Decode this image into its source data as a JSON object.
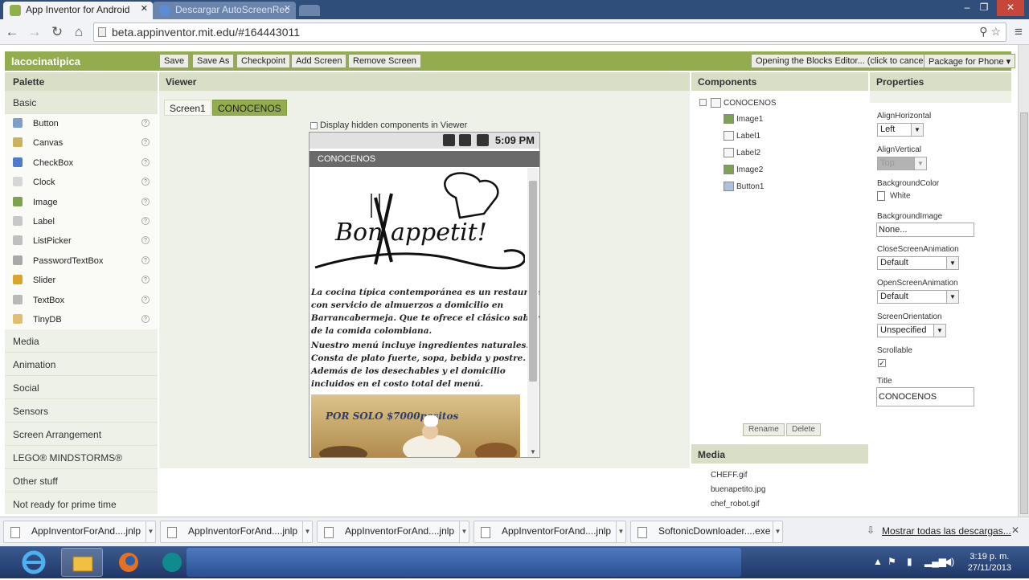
{
  "browser": {
    "tabs": [
      {
        "label": "App Inventor for Android"
      },
      {
        "label": "Descargar AutoScreenRec"
      }
    ],
    "url": "beta.appinventor.mit.edu/#164443011"
  },
  "app": {
    "project_name": "lacocinatipica",
    "toolbar": {
      "save": "Save",
      "save_as": "Save As",
      "checkpoint": "Checkpoint",
      "add_screen": "Add Screen",
      "remove_screen": "Remove Screen",
      "blocks_editor": "Opening the Blocks Editor... (click to cancel)",
      "package": "Package for Phone ▾"
    }
  },
  "palette": {
    "title": "Palette",
    "basic_label": "Basic",
    "basic_items": [
      {
        "label": "Button",
        "icon": "button-icon",
        "color": "#7d9fc9"
      },
      {
        "label": "Canvas",
        "icon": "canvas-icon",
        "color": "#c9b35c"
      },
      {
        "label": "CheckBox",
        "icon": "checkbox-icon",
        "color": "#4e7cc9"
      },
      {
        "label": "Clock",
        "icon": "clock-icon",
        "color": "#d7d7d7"
      },
      {
        "label": "Image",
        "icon": "image-icon",
        "color": "#7ea34f"
      },
      {
        "label": "Label",
        "icon": "label-icon",
        "color": "#c8c8c8"
      },
      {
        "label": "ListPicker",
        "icon": "listpicker-icon",
        "color": "#bfbfbf"
      },
      {
        "label": "PasswordTextBox",
        "icon": "password-icon",
        "color": "#a9a9a9"
      },
      {
        "label": "Slider",
        "icon": "slider-icon",
        "color": "#d9a52b"
      },
      {
        "label": "TextBox",
        "icon": "textbox-icon",
        "color": "#b9b9b9"
      },
      {
        "label": "TinyDB",
        "icon": "tinydb-icon",
        "color": "#e0c070"
      }
    ],
    "categories": [
      "Media",
      "Animation",
      "Social",
      "Sensors",
      "Screen Arrangement",
      "LEGO® MINDSTORMS®",
      "Other stuff",
      "Not ready for prime time"
    ]
  },
  "viewer": {
    "title": "Viewer",
    "screen_tabs": [
      "Screen1",
      "CONOCENOS"
    ],
    "hidden_components_label": "Display hidden components in Viewer",
    "phone_time": "5:09 PM",
    "phone_title": "CONOCENOS",
    "logo_text": "Bon appetit!",
    "paragraph1": [
      "La cocina típica contemporánea es un restaurante",
      "con servicio de almuerzos a domicilio en",
      "Barrancabermeja. Que te ofrece el clásico sabor",
      "de la comida colombiana."
    ],
    "paragraph2": [
      "Nuestro menú incluye ingredientes naturales.",
      "Consta de plato fuerte, sopa, bebida y postre.",
      "Además de los desechables y el domicilio",
      "incluidos en el costo total del menú."
    ],
    "banner_text": "POR SOLO $7000pesitos"
  },
  "components": {
    "title": "Components",
    "root": "CONOCENOS",
    "items": [
      "Image1",
      "Label1",
      "Label2",
      "Image2",
      "Button1"
    ],
    "rename": "Rename",
    "delete": "Delete"
  },
  "media": {
    "title": "Media",
    "files": [
      "CHEFF.gif",
      "buenapetito.jpg",
      "chef_robot.gif"
    ]
  },
  "properties": {
    "title": "Properties",
    "align_horizontal_label": "AlignHorizontal",
    "align_horizontal_value": "Left",
    "align_vertical_label": "AlignVertical",
    "align_vertical_value": "Top",
    "background_color_label": "BackgroundColor",
    "background_color_value": "White",
    "background_image_label": "BackgroundImage",
    "background_image_value": "None...",
    "close_anim_label": "CloseScreenAnimation",
    "close_anim_value": "Default",
    "open_anim_label": "OpenScreenAnimation",
    "open_anim_value": "Default",
    "orientation_label": "ScreenOrientation",
    "orientation_value": "Unspecified",
    "scrollable_label": "Scrollable",
    "scrollable_checked": true,
    "title_label": "Title",
    "title_value": "CONOCENOS"
  },
  "downloads": {
    "items": [
      "AppInventorForAnd....jnlp",
      "AppInventorForAnd....jnlp",
      "AppInventorForAnd....jnlp",
      "AppInventorForAnd....jnlp",
      "SoftonicDownloader....exe"
    ],
    "show_all": "Mostrar todas las descargas..."
  },
  "taskbar": {
    "time": "3:19 p. m.",
    "date": "27/11/2013"
  },
  "colors": {
    "accent_green": "#93ac4d",
    "panel_header": "#d8dfc6",
    "tab_strip": "#2f4f7a"
  }
}
